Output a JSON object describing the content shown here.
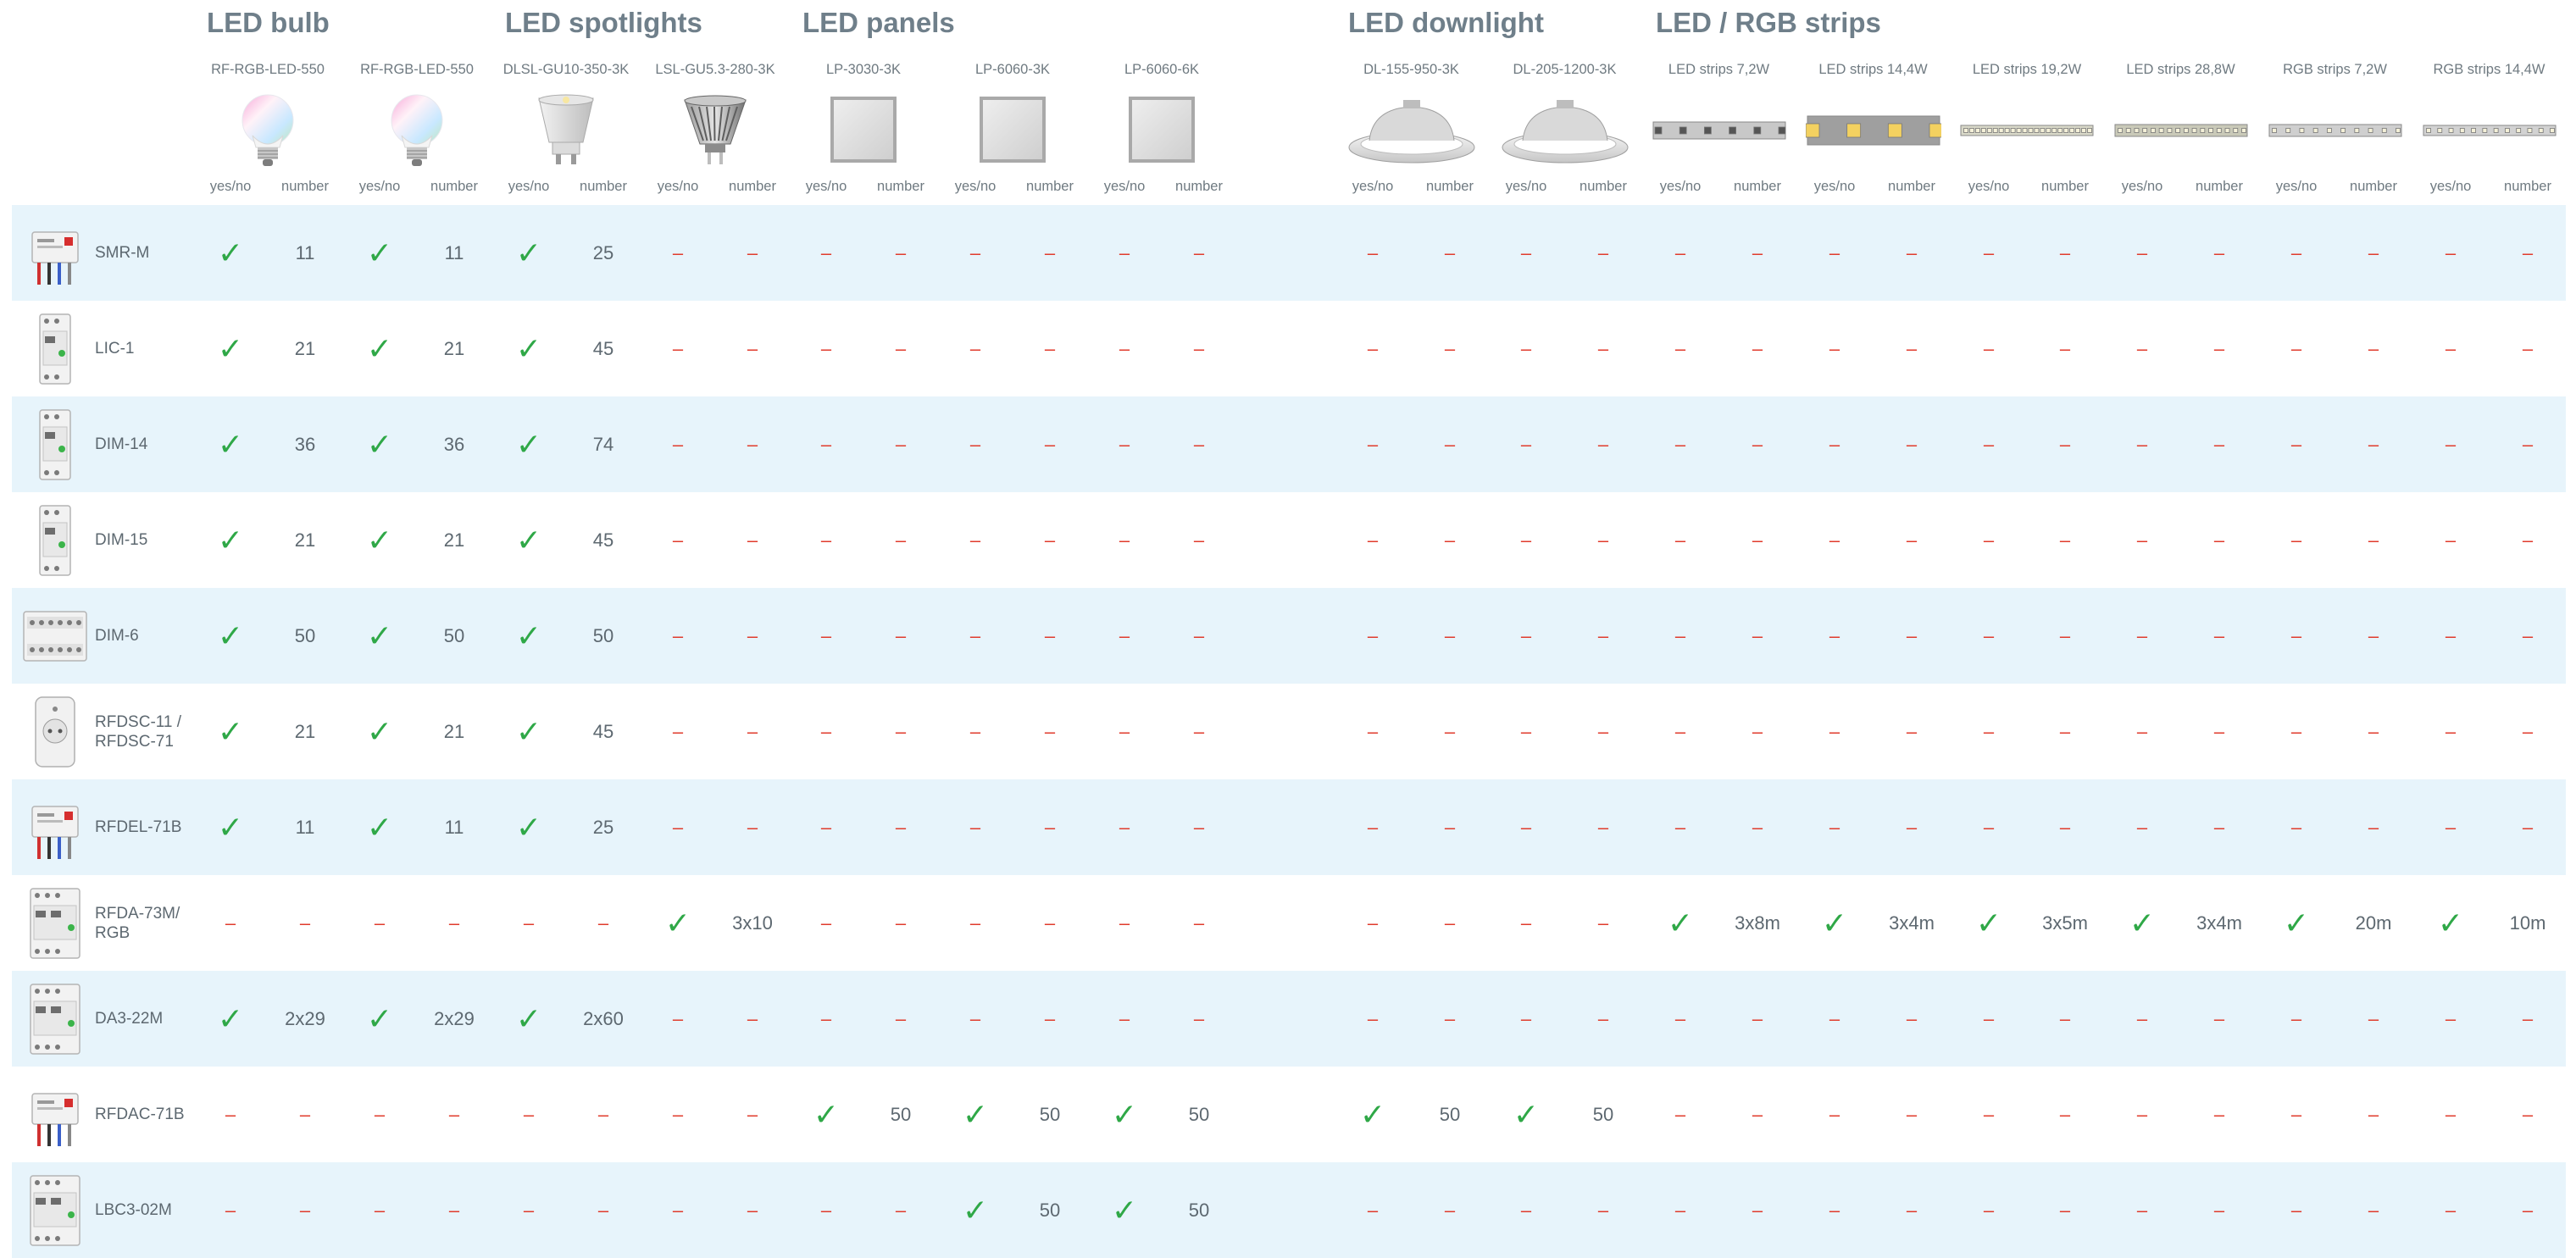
{
  "groups": [
    {
      "title": "LED bulb"
    },
    {
      "title": "LED spotlights"
    },
    {
      "title": "LED panels"
    },
    {
      "title": "LED downlight"
    },
    {
      "title": "LED / RGB strips"
    }
  ],
  "products": [
    {
      "name": "RF-RGB-LED-550",
      "icon": "rgb-bulb-icon"
    },
    {
      "name": "RF-RGB-LED-550",
      "icon": "rgb-bulb-icon"
    },
    {
      "name": "DLSL-GU10-350-3K",
      "icon": "gu10-spotlight-icon"
    },
    {
      "name": "LSL-GU5.3-280-3K",
      "icon": "mr16-spotlight-icon"
    },
    {
      "name": "LP-3030-3K",
      "icon": "led-panel-icon"
    },
    {
      "name": "LP-6060-3K",
      "icon": "led-panel-icon"
    },
    {
      "name": "LP-6060-6K",
      "icon": "led-panel-icon"
    },
    {
      "name": "DL-155-950-3K",
      "icon": "downlight-icon"
    },
    {
      "name": "DL-205-1200-3K",
      "icon": "downlight-icon"
    },
    {
      "name": "LED strips 7,2W",
      "icon": "led-strip-icon"
    },
    {
      "name": "LED strips 14,4W",
      "icon": "led-strip-icon"
    },
    {
      "name": "LED strips 19,2W",
      "icon": "led-strip-icon"
    },
    {
      "name": "LED strips 28,8W",
      "icon": "led-strip-icon"
    },
    {
      "name": "RGB strips 7,2W",
      "icon": "led-strip-icon"
    },
    {
      "name": "RGB strips 14,4W",
      "icon": "led-strip-icon"
    }
  ],
  "subheaders": {
    "yes": "yes/no",
    "num": "number"
  },
  "marks": {
    "yes": "✓",
    "no": "–"
  },
  "colors": {
    "check": "#2fa847",
    "dash": "#e03b2c",
    "row_shade": "#e7f4fb",
    "title": "#6f7f8a"
  },
  "rows": [
    {
      "device": "SMR-M",
      "icon": "smr-m-module-icon",
      "values": [
        "Y",
        "11",
        "Y",
        "11",
        "Y",
        "25",
        "N",
        "N",
        "N",
        "N",
        "N",
        "N",
        "N",
        "N",
        "N",
        "N",
        "N",
        "N",
        "N",
        "N",
        "N",
        "N",
        "N",
        "N",
        "N",
        "N",
        "N",
        "N",
        "N",
        "N"
      ]
    },
    {
      "device": "LIC-1",
      "icon": "lic-1-din-module-icon",
      "values": [
        "Y",
        "21",
        "Y",
        "21",
        "Y",
        "45",
        "N",
        "N",
        "N",
        "N",
        "N",
        "N",
        "N",
        "N",
        "N",
        "N",
        "N",
        "N",
        "N",
        "N",
        "N",
        "N",
        "N",
        "N",
        "N",
        "N",
        "N",
        "N",
        "N",
        "N"
      ]
    },
    {
      "device": "DIM-14",
      "icon": "dim-14-din-module-icon",
      "values": [
        "Y",
        "36",
        "Y",
        "36",
        "Y",
        "74",
        "N",
        "N",
        "N",
        "N",
        "N",
        "N",
        "N",
        "N",
        "N",
        "N",
        "N",
        "N",
        "N",
        "N",
        "N",
        "N",
        "N",
        "N",
        "N",
        "N",
        "N",
        "N",
        "N",
        "N"
      ]
    },
    {
      "device": "DIM-15",
      "icon": "dim-15-din-module-icon",
      "values": [
        "Y",
        "21",
        "Y",
        "21",
        "Y",
        "45",
        "N",
        "N",
        "N",
        "N",
        "N",
        "N",
        "N",
        "N",
        "N",
        "N",
        "N",
        "N",
        "N",
        "N",
        "N",
        "N",
        "N",
        "N",
        "N",
        "N",
        "N",
        "N",
        "N",
        "N"
      ]
    },
    {
      "device": "DIM-6",
      "icon": "dim-6-din-module-icon",
      "values": [
        "Y",
        "50",
        "Y",
        "50",
        "Y",
        "50",
        "N",
        "N",
        "N",
        "N",
        "N",
        "N",
        "N",
        "N",
        "N",
        "N",
        "N",
        "N",
        "N",
        "N",
        "N",
        "N",
        "N",
        "N",
        "N",
        "N",
        "N",
        "N",
        "N",
        "N"
      ]
    },
    {
      "device": "RFDSC-11 / RFDSC-71",
      "icon": "socket-dimmer-icon",
      "values": [
        "Y",
        "21",
        "Y",
        "21",
        "Y",
        "45",
        "N",
        "N",
        "N",
        "N",
        "N",
        "N",
        "N",
        "N",
        "N",
        "N",
        "N",
        "N",
        "N",
        "N",
        "N",
        "N",
        "N",
        "N",
        "N",
        "N",
        "N",
        "N",
        "N",
        "N"
      ]
    },
    {
      "device": "RFDEL-71B",
      "icon": "rfdel-71b-module-icon",
      "values": [
        "Y",
        "11",
        "Y",
        "11",
        "Y",
        "25",
        "N",
        "N",
        "N",
        "N",
        "N",
        "N",
        "N",
        "N",
        "N",
        "N",
        "N",
        "N",
        "N",
        "N",
        "N",
        "N",
        "N",
        "N",
        "N",
        "N",
        "N",
        "N",
        "N",
        "N"
      ]
    },
    {
      "device": "RFDA-73M/ RGB",
      "icon": "rfda-73m-module-icon",
      "values": [
        "N",
        "N",
        "N",
        "N",
        "N",
        "N",
        "Y",
        "3x10",
        "N",
        "N",
        "N",
        "N",
        "N",
        "N",
        "N",
        "N",
        "N",
        "N",
        "Y",
        "3x8m",
        "Y",
        "3x4m",
        "Y",
        "3x5m",
        "Y",
        "3x4m",
        "Y",
        "20m",
        "Y",
        "10m"
      ]
    },
    {
      "device": "DA3-22M",
      "icon": "da3-22m-module-icon",
      "values": [
        "Y",
        "2x29",
        "Y",
        "2x29",
        "Y",
        "2x60",
        "N",
        "N",
        "N",
        "N",
        "N",
        "N",
        "N",
        "N",
        "N",
        "N",
        "N",
        "N",
        "N",
        "N",
        "N",
        "N",
        "N",
        "N",
        "N",
        "N",
        "N",
        "N",
        "N",
        "N"
      ]
    },
    {
      "device": "RFDAC-71B",
      "icon": "rfdac-71b-module-icon",
      "values": [
        "N",
        "N",
        "N",
        "N",
        "N",
        "N",
        "N",
        "N",
        "Y",
        "50",
        "Y",
        "50",
        "Y",
        "50",
        "Y",
        "50",
        "Y",
        "50",
        "N",
        "N",
        "N",
        "N",
        "N",
        "N",
        "N",
        "N",
        "N",
        "N",
        "N",
        "N"
      ]
    },
    {
      "device": "LBC3-02M",
      "icon": "lbc3-02m-module-icon",
      "values": [
        "N",
        "N",
        "N",
        "N",
        "N",
        "N",
        "N",
        "N",
        "N",
        "N",
        "Y",
        "50",
        "Y",
        "50",
        "N",
        "N",
        "N",
        "N",
        "N",
        "N",
        "N",
        "N",
        "N",
        "N",
        "N",
        "N",
        "N",
        "N",
        "N",
        "N"
      ]
    }
  ]
}
